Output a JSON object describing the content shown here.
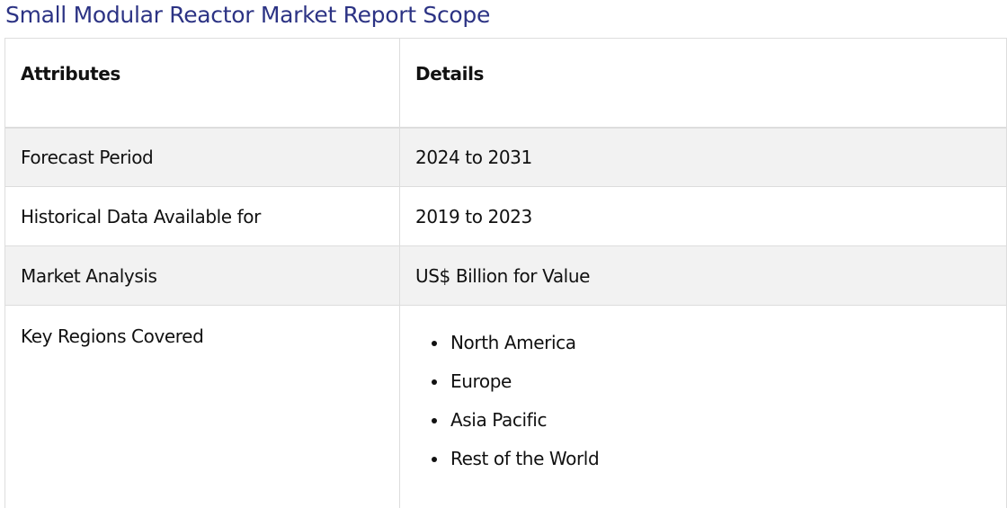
{
  "title": "Small Modular Reactor Market Report Scope",
  "table": {
    "headers": [
      "Attributes",
      "Details"
    ],
    "rows": [
      {
        "attribute": "Forecast Period",
        "detail": "2024 to 2031"
      },
      {
        "attribute": "Historical Data Available for",
        "detail": "2019 to 2023"
      },
      {
        "attribute": "Market Analysis",
        "detail": "US$ Billion for Value"
      }
    ],
    "regions": {
      "attribute": "Key Regions Covered",
      "items": [
        "North America",
        "Europe",
        "Asia Pacific",
        "Rest of the World"
      ]
    }
  },
  "colors": {
    "title": "#2c3384",
    "shaded_row": "#f2f2f2",
    "border": "#dddddd"
  }
}
